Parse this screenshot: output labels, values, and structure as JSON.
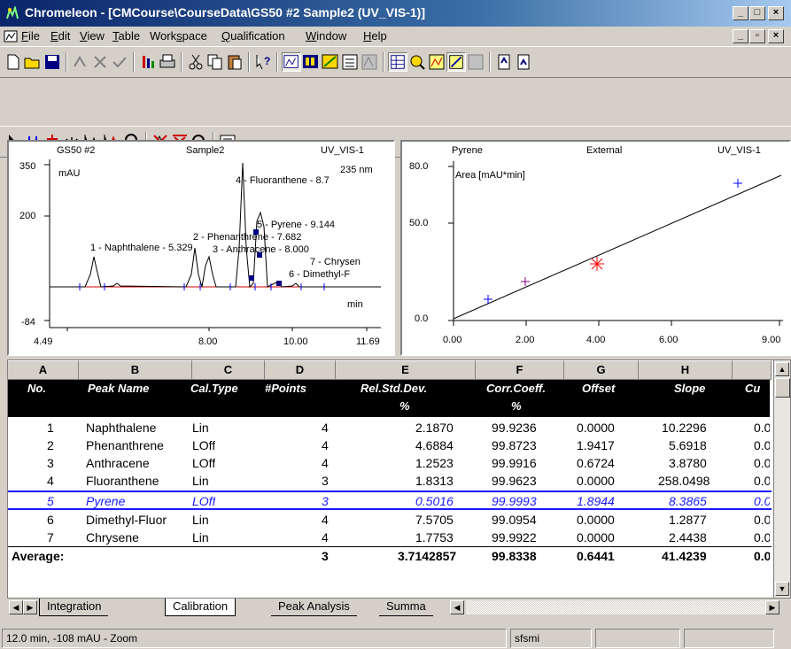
{
  "window": {
    "title": "Chromeleon - [CMCourse\\CourseData\\GS50 #2 Sample2 (UV_VIS-1)]",
    "caption_min": "_",
    "caption_max": "□",
    "caption_close": "×",
    "doc_min": "_",
    "doc_restore": "▫",
    "doc_close": "×"
  },
  "menu": [
    {
      "label": "File",
      "u": "F",
      "rest": "ile"
    },
    {
      "label": "Edit",
      "u": "E",
      "rest": "dit"
    },
    {
      "label": "View",
      "u": "V",
      "rest": "iew"
    },
    {
      "label": "Table",
      "u": "T",
      "rest": "able"
    },
    {
      "label": "Workspace",
      "pre": "Work",
      "u": "s",
      "rest": "pace"
    },
    {
      "label": "Qualification",
      "u": "Q",
      "rest": "ualification"
    },
    {
      "label": "Window",
      "u": "W",
      "rest": "indow"
    },
    {
      "label": "Help",
      "u": "H",
      "rest": "elp"
    }
  ],
  "chromatogram": {
    "header_left": "GS50 #2",
    "header_mid": "Sample2",
    "header_right": "UV_VIS-1",
    "y_unit": "mAU",
    "wavelength": "235 nm",
    "x_unit": "min",
    "y_ticks": [
      "350",
      "200",
      "-84"
    ],
    "x_ticks": [
      "4.49",
      "8.00",
      "10.00",
      "11.69"
    ],
    "peaks": [
      {
        "label": "1 - Naphthalene - 5.329"
      },
      {
        "label": "2 - Phenanthrene - 7.682"
      },
      {
        "label": "3 - Anthracene - 8.000"
      },
      {
        "label": "4 - Fluoranthene - 8.7"
      },
      {
        "label": "5 - Pyrene - 9.144"
      },
      {
        "label": "6 - Dimethyl-F"
      },
      {
        "label": "7 - Chrysen"
      }
    ]
  },
  "calibration_plot": {
    "header_left": "Pyrene",
    "header_mid": "External",
    "header_right": "UV_VIS-1",
    "y_label": "Area  [mAU*min]",
    "y_ticks": [
      "80.0",
      "50.0",
      "0.0"
    ],
    "x_ticks": [
      "0.00",
      "2.00",
      "4.00",
      "6.00",
      "9.00"
    ]
  },
  "table": {
    "columns": [
      "A",
      "B",
      "C",
      "D",
      "E",
      "F",
      "G",
      "H"
    ],
    "headers": [
      "No.",
      "Peak Name",
      "Cal.Type",
      "#Points",
      "Rel.Std.Dev.",
      "Corr.Coeff.",
      "Offset",
      "Slope",
      "Cu"
    ],
    "units": [
      "",
      "",
      "",
      "",
      "%",
      "%",
      "",
      "",
      ""
    ],
    "rows": [
      {
        "no": "1",
        "name": "Naphthalene",
        "type": "Lin",
        "points": "4",
        "rsd": "2.1870",
        "corr": "99.9236",
        "offset": "0.0000",
        "slope": "10.2296",
        "cu": "0.0"
      },
      {
        "no": "2",
        "name": "Phenanthrene",
        "type": "LOff",
        "points": "4",
        "rsd": "4.6884",
        "corr": "99.8723",
        "offset": "1.9417",
        "slope": "5.6918",
        "cu": "0.0"
      },
      {
        "no": "3",
        "name": "Anthracene",
        "type": "LOff",
        "points": "4",
        "rsd": "1.2523",
        "corr": "99.9916",
        "offset": "0.6724",
        "slope": "3.8780",
        "cu": "0.0"
      },
      {
        "no": "4",
        "name": "Fluoranthene",
        "type": "Lin",
        "points": "3",
        "rsd": "1.8313",
        "corr": "99.9623",
        "offset": "0.0000",
        "slope": "258.0498",
        "cu": "0.0"
      },
      {
        "no": "5",
        "name": "Pyrene",
        "type": "LOff",
        "points": "3",
        "rsd": "0.5016",
        "corr": "99.9993",
        "offset": "1.8944",
        "slope": "8.3865",
        "cu": "0.0"
      },
      {
        "no": "6",
        "name": "Dimethyl-Fluor",
        "type": "Lin",
        "points": "4",
        "rsd": "7.5705",
        "corr": "99.0954",
        "offset": "0.0000",
        "slope": "1.2877",
        "cu": "0.0"
      },
      {
        "no": "7",
        "name": "Chrysene",
        "type": "Lin",
        "points": "4",
        "rsd": "1.7753",
        "corr": "99.9922",
        "offset": "0.0000",
        "slope": "2.4438",
        "cu": "0.0"
      }
    ],
    "average": {
      "label": "Average:",
      "points": "3",
      "rsd": "3.7142857",
      "corr": "99.8338",
      "offset": "0.6441",
      "slope": "41.4239",
      "cu": "0.0"
    }
  },
  "tabs": [
    "Integration",
    "Calibration",
    "Peak Analysis",
    "Summa"
  ],
  "status": {
    "coords": "12.0 min, -108 mAU - Zoom",
    "user": "sfsmi"
  }
}
